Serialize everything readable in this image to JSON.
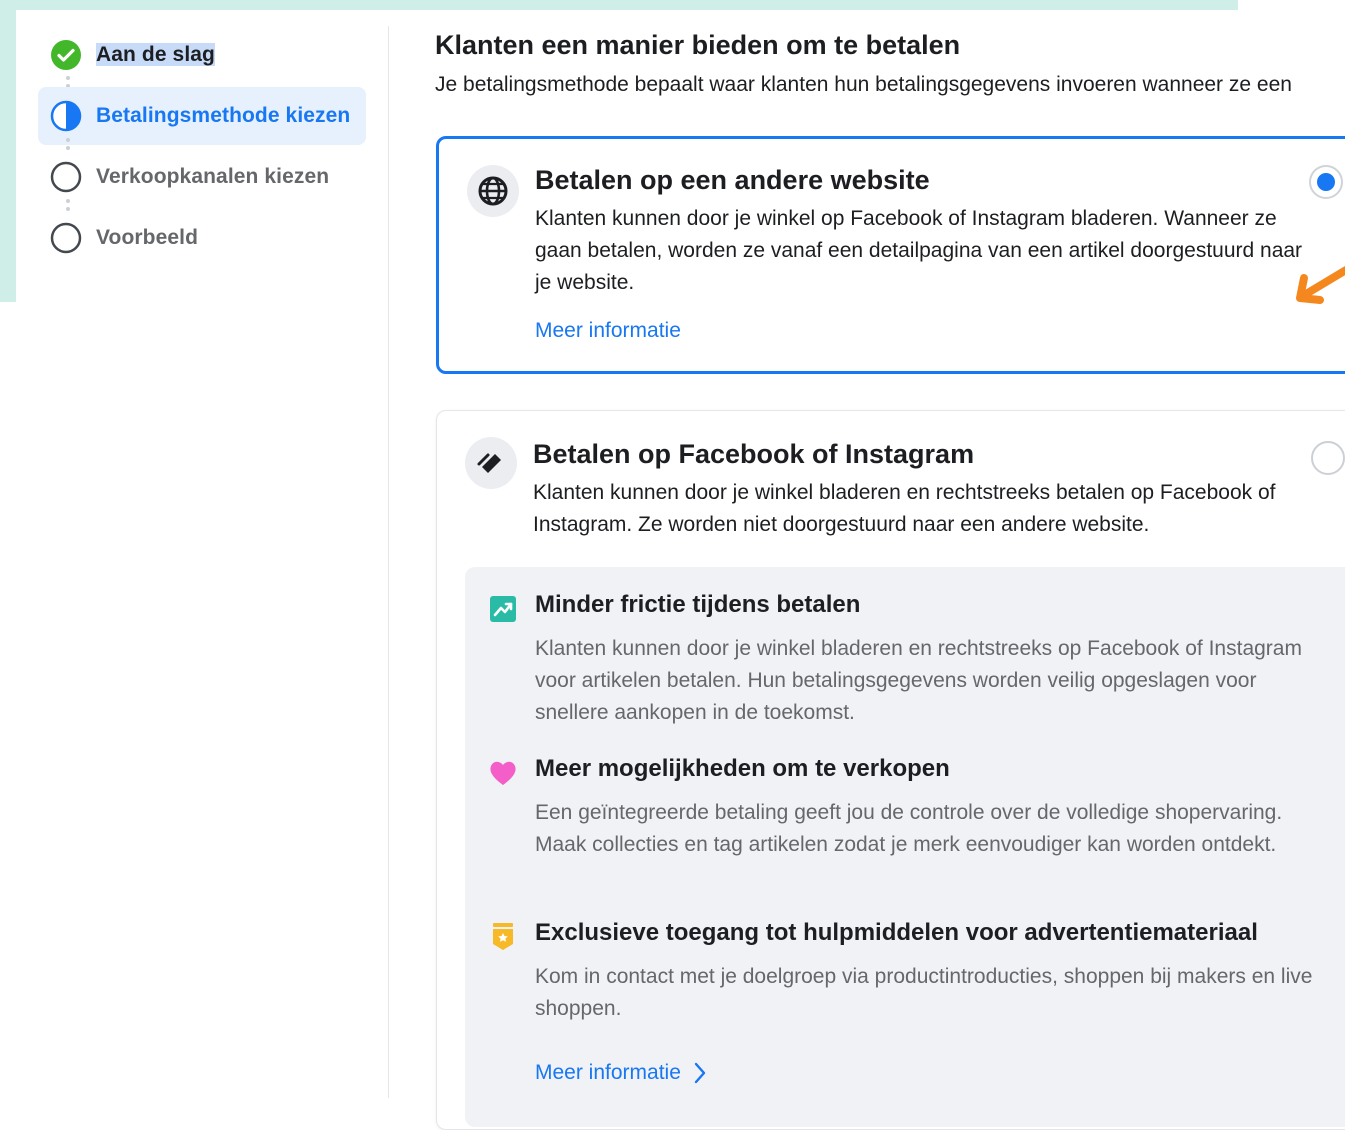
{
  "sidebar": {
    "steps": [
      {
        "label": "Aan de slag",
        "state": "done"
      },
      {
        "label": "Betalingsmethode kiezen",
        "state": "active"
      },
      {
        "label": "Verkoopkanalen kiezen",
        "state": "todo"
      },
      {
        "label": "Voorbeeld",
        "state": "todo"
      }
    ]
  },
  "header": {
    "title": "Klanten een manier bieden om te betalen",
    "subtitle": "Je betalingsmethode bepaalt waar klanten hun betalingsgegevens invoeren wanneer ze een"
  },
  "options": [
    {
      "icon": "globe-icon",
      "title": "Betalen op een andere website",
      "description": "Klanten kunnen door je winkel op Facebook of Instagram bladeren. Wanneer ze gaan betalen, worden ze vanaf een detailpagina van een artikel doorgestuurd naar je website.",
      "link": "Meer informatie",
      "selected": true
    },
    {
      "icon": "checkout-tag-icon",
      "title": "Betalen op Facebook of Instagram",
      "description": "Klanten kunnen door je winkel bladeren en rechtstreeks betalen op Facebook of Instagram. Ze worden niet doorgestuurd naar een andere website.",
      "link": "Meer informatie",
      "selected": false
    }
  ],
  "benefits": [
    {
      "icon": "trend-up-icon",
      "title": "Minder frictie tijdens betalen",
      "description": "Klanten kunnen door je winkel bladeren en rechtstreeks op Facebook of Instagram voor artikelen betalen. Hun betalingsgegevens worden veilig opgeslagen voor snellere aankopen in de toekomst."
    },
    {
      "icon": "heart-icon",
      "title": "Meer mogelijkheden om te verkopen",
      "description": "Een geïntegreerde betaling geeft jou de controle over de volledige shopervaring. Maak collecties en tag artikelen zodat je merk eenvoudiger kan worden ontdekt."
    },
    {
      "icon": "badge-icon",
      "title": "Exclusieve toegang tot hulpmiddelen voor advertentiemateriaal",
      "description": "Kom in contact met je doelgroep via productintroducties, shoppen bij makers en live shoppen."
    }
  ],
  "colors": {
    "accent": "#1877f2",
    "done": "#42b72a",
    "teal_frame": "#cfeee7",
    "annotation_arrow": "#f5871f",
    "trend_icon": "#2abba7",
    "heart_icon": "#f35ec8",
    "badge_icon": "#f7b928"
  }
}
